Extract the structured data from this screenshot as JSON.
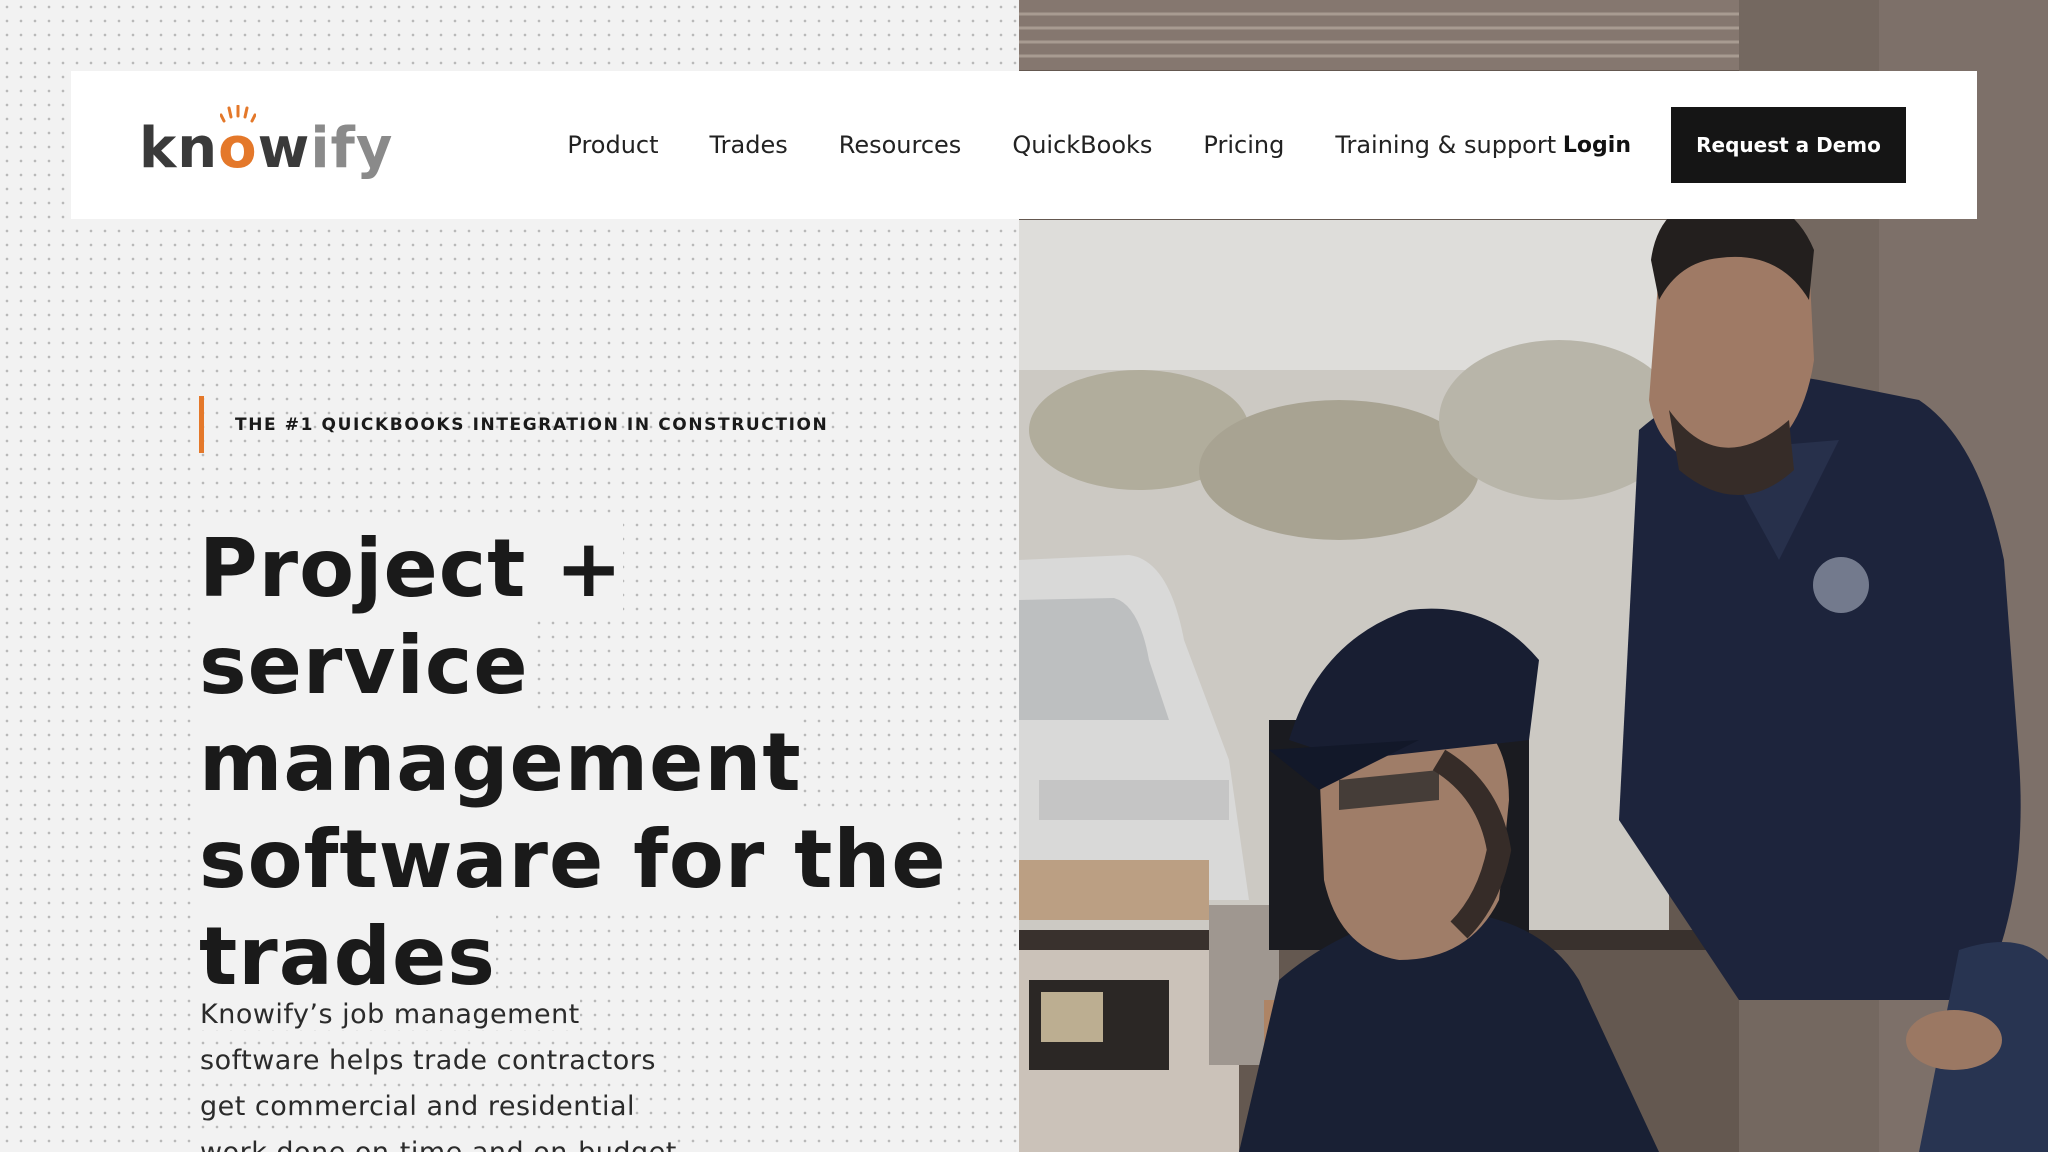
{
  "brand": {
    "logo_parts": [
      "kn",
      "o",
      "w",
      "ify"
    ],
    "accent_color": "#e4782a"
  },
  "nav": {
    "links": [
      "Product",
      "Trades",
      "Resources",
      "QuickBooks",
      "Pricing",
      "Training & support"
    ],
    "login_label": "Login",
    "demo_label": "Request a Demo"
  },
  "hero": {
    "eyebrow": "THE #1 QUICKBOOKS INTEGRATION IN CONSTRUCTION",
    "headline": "Project + service management software for the trades",
    "subcopy": "Knowify’s job management software helps trade contractors get commercial and residential work done on-time and on-budget"
  }
}
